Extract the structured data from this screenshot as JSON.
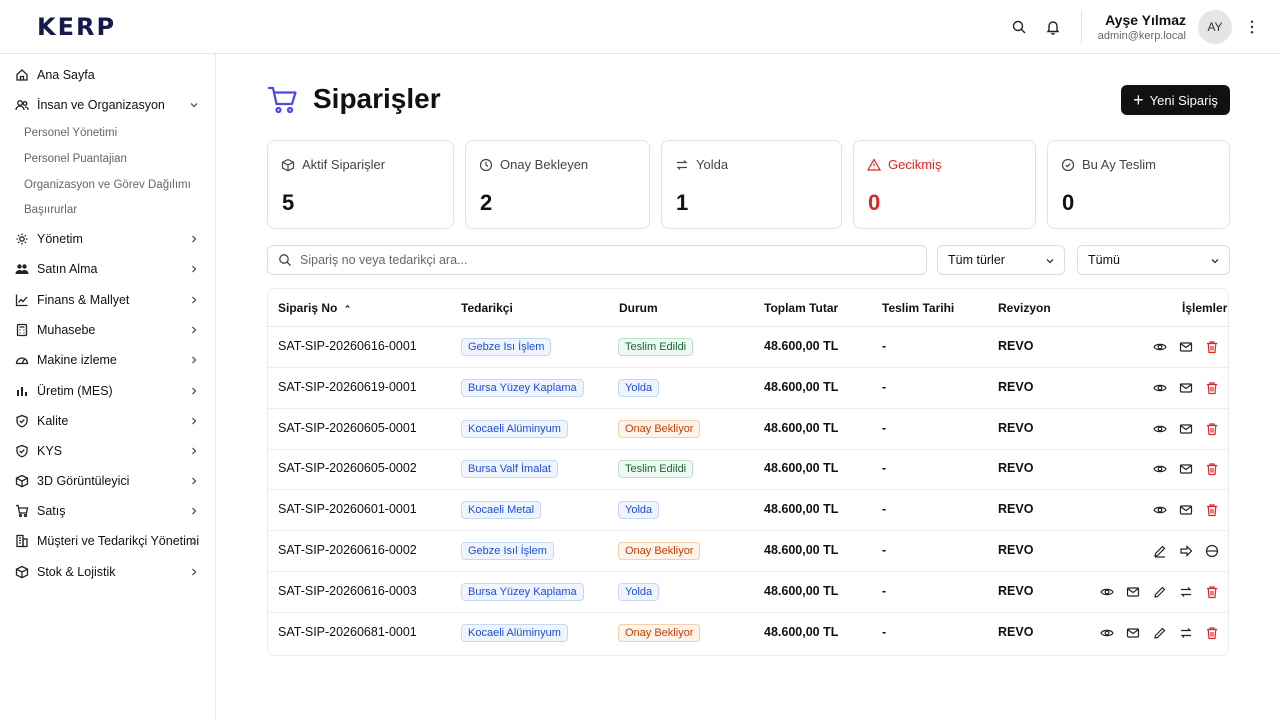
{
  "app": {
    "logo": "KERP"
  },
  "user": {
    "name": "Ayşe Yılmaz",
    "email": "admin@kerp.local",
    "initials": "AY"
  },
  "sidebar": {
    "home": "Ana Sayfa",
    "hr_section": "İnsan ve Organizasyon",
    "hr_sub": [
      "Personel Yönetimi",
      "Personel Puantajian",
      "Organizasyon ve Görev Dağılımı",
      "Başıırurlar"
    ],
    "items": [
      "Yönetim",
      "Satın Alma",
      "Finans & Mallyet",
      "Muhasebe",
      "Makine izleme",
      "Üretim (MES)",
      "Kalite",
      "KYS",
      "3D Görüntüleyici",
      "Satış",
      "Müşteri ve Tedarikçi Yönetimi",
      "Stok & Lojistik"
    ]
  },
  "page": {
    "title": "Siparişler",
    "new_button": "Yeni Sipariş"
  },
  "stats": [
    {
      "label": "Aktif Siparişler",
      "value": "5",
      "icon": "package-icon"
    },
    {
      "label": "Onay Bekleyen",
      "value": "2",
      "icon": "clock-icon"
    },
    {
      "label": "Yolda",
      "value": "1",
      "icon": "transfer-icon"
    },
    {
      "label": "Gecikmiş",
      "value": "0",
      "icon": "alert-triangle-icon",
      "color": "#dc2626"
    },
    {
      "label": "Bu Ay Teslim",
      "value": "0",
      "icon": "check-circle-icon"
    }
  ],
  "filters": {
    "search_placeholder": "Sipariş no veya tedarikçi ara...",
    "type_select": "Tüm türler",
    "status_select": "Tümü"
  },
  "table": {
    "columns": [
      "Sipariş No",
      "Tedarikçi",
      "Durum",
      "Toplam Tutar",
      "Teslim Tarihi",
      "Revizyon",
      "İşlemler"
    ],
    "rows": [
      {
        "no": "SAT-SIP-20260616-0001",
        "supplier": "Gebze Isı İşlem",
        "status": "Teslim Edildi",
        "status_kind": "green",
        "total": "48.600,00 TL",
        "date": "-",
        "rev": "REVO"
      },
      {
        "no": "SAT-SIP-20260619-0001",
        "supplier": "Bursa Yüzey Kaplama",
        "status": "Yolda",
        "status_kind": "blue",
        "total": "48.600,00 TL",
        "date": "-",
        "rev": "REVO"
      },
      {
        "no": "SAT-SIP-20260605-0001",
        "supplier": "Kocaeli Alüminyum",
        "status": "Onay Bekliyor",
        "status_kind": "orange",
        "total": "48.600,00 TL",
        "date": "-",
        "rev": "REVO"
      },
      {
        "no": "SAT-SIP-20260605-0002",
        "supplier": "Bursa Valf İmalat",
        "status": "Teslim Edildi",
        "status_kind": "green",
        "total": "48.600,00 TL",
        "date": "-",
        "rev": "REVO"
      },
      {
        "no": "SAT-SIP-20260601-0001",
        "supplier": "Kocaeli Metal",
        "status": "Yolda",
        "status_kind": "blue",
        "total": "48.600,00 TL",
        "date": "-",
        "rev": "REVO"
      },
      {
        "no": "SAT-SIP-20260616-0002",
        "supplier": "Gebze Isıl İşlem",
        "status": "Onay Bekliyor",
        "status_kind": "orange",
        "total": "48.600,00 TL",
        "date": "-",
        "rev": "REVO"
      },
      {
        "no": "SAT-SIP-20260616-0003",
        "supplier": "Bursa Yüzey Kaplama",
        "status": "Yolda",
        "status_kind": "blue",
        "total": "48.600,00 TL",
        "date": "-",
        "rev": "REVO"
      },
      {
        "no": "SAT-SIP-20260681-0001",
        "supplier": "Kocaeli Alüminyum",
        "status": "Onay Bekliyor",
        "status_kind": "orange",
        "total": "48.600,00 TL",
        "date": "-",
        "rev": "REVO"
      }
    ]
  },
  "colors": {
    "accent_purple": "#4f46e5",
    "danger": "#dc2626",
    "dark_button": "#111111",
    "logo": "#161a4a"
  }
}
